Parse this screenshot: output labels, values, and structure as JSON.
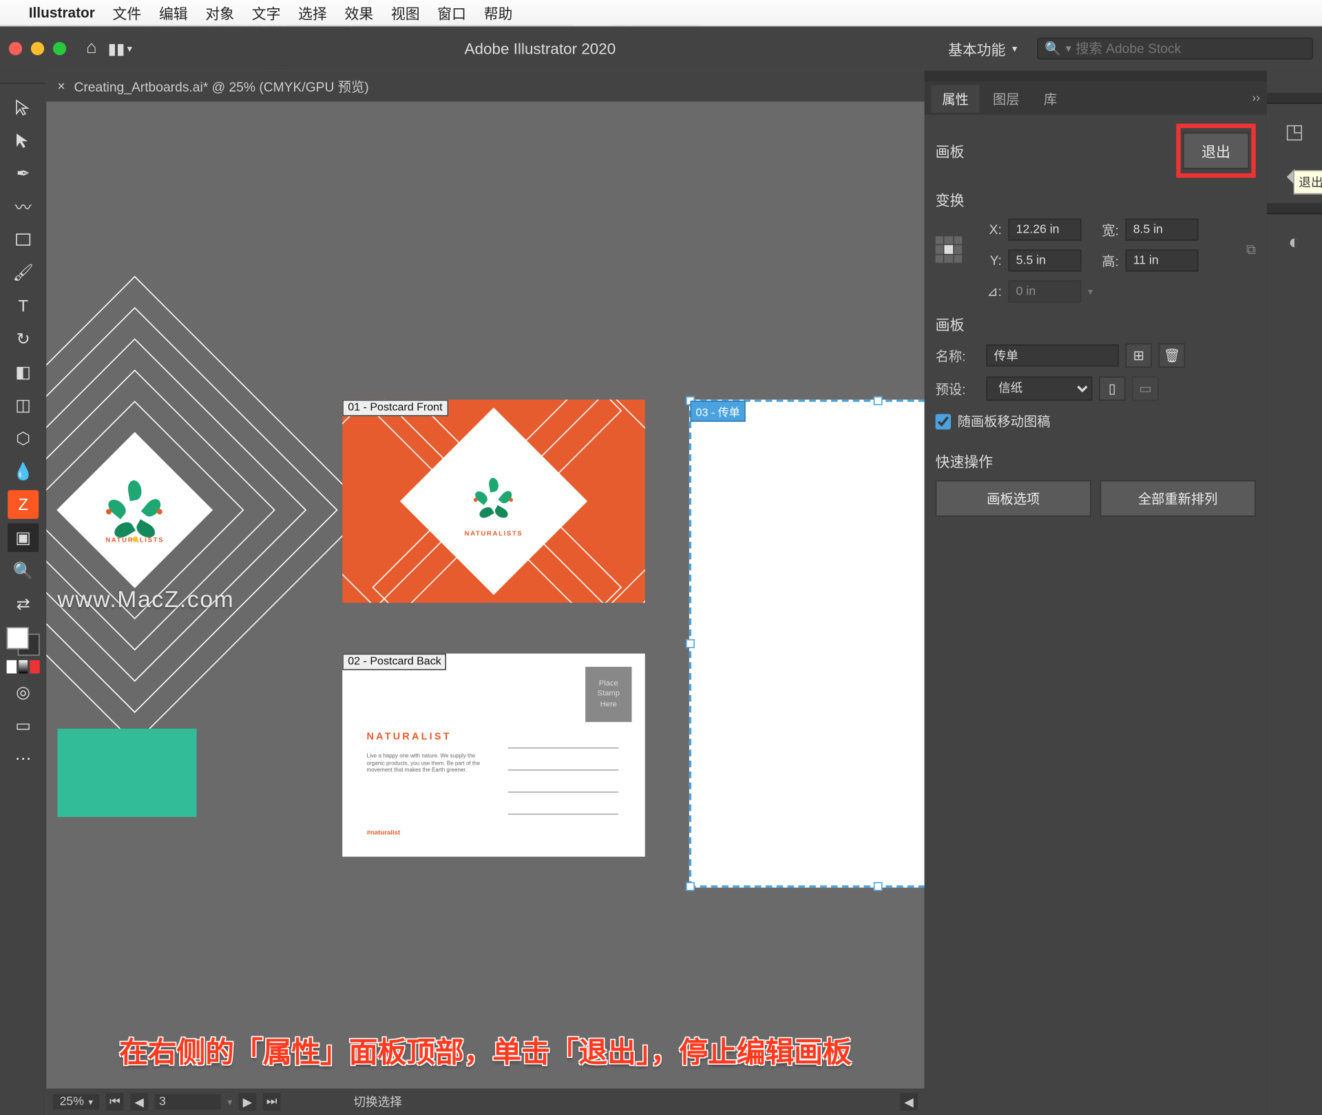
{
  "menubar": {
    "appname": "Illustrator",
    "items": [
      "文件",
      "编辑",
      "对象",
      "文字",
      "选择",
      "效果",
      "视图",
      "窗口",
      "帮助"
    ]
  },
  "appbar": {
    "title": "Adobe Illustrator 2020",
    "workspace": "基本功能",
    "search_placeholder": "搜索 Adobe Stock"
  },
  "document": {
    "tab": "Creating_Artboards.ai* @ 25% (CMYK/GPU 预览)",
    "watermark": "www.MacZ.com"
  },
  "artboards": {
    "ab1_label": "01 - Postcard Front",
    "ab2_label": "02 - Postcard Back",
    "ab3_label": "03 - 传单",
    "postcard_front": {
      "logo_text": "NATURALISTS"
    },
    "postcard_back": {
      "stamp": [
        "Place",
        "Stamp",
        "Here"
      ],
      "title": "NATURALIST",
      "body": "Live a happy one with nature. We supply the organic products, you use them. Be part of the movement that makes the Earth greener.",
      "tag": "#naturalist"
    }
  },
  "panel": {
    "tabs": [
      "属性",
      "图层",
      "库"
    ],
    "section_artboard": "画板",
    "exit_label": "退出",
    "tooltip_exit": "退出画板编辑模式",
    "section_transform": "变换",
    "x_label": "X:",
    "x_value": "12.26 in",
    "y_label": "Y:",
    "y_value": "5.5 in",
    "w_label": "宽:",
    "w_value": "8.5 in",
    "h_label": "高:",
    "h_value": "11 in",
    "angle_label": "⊿:",
    "angle_value": "0 in",
    "section_artboards": "画板",
    "name_label": "名称:",
    "name_value": "传单",
    "preset_label": "预设:",
    "preset_value": "信纸",
    "checkbox_move": "随画板移动图稿",
    "section_quick": "快速操作",
    "quick1": "画板选项",
    "quick2": "全部重新排列"
  },
  "statusbar": {
    "zoom": "25%",
    "artboard_num": "3",
    "switch_label": "切换选择"
  },
  "caption": "在右侧的「属性」面板顶部，单击「退出」，停止编辑画板"
}
